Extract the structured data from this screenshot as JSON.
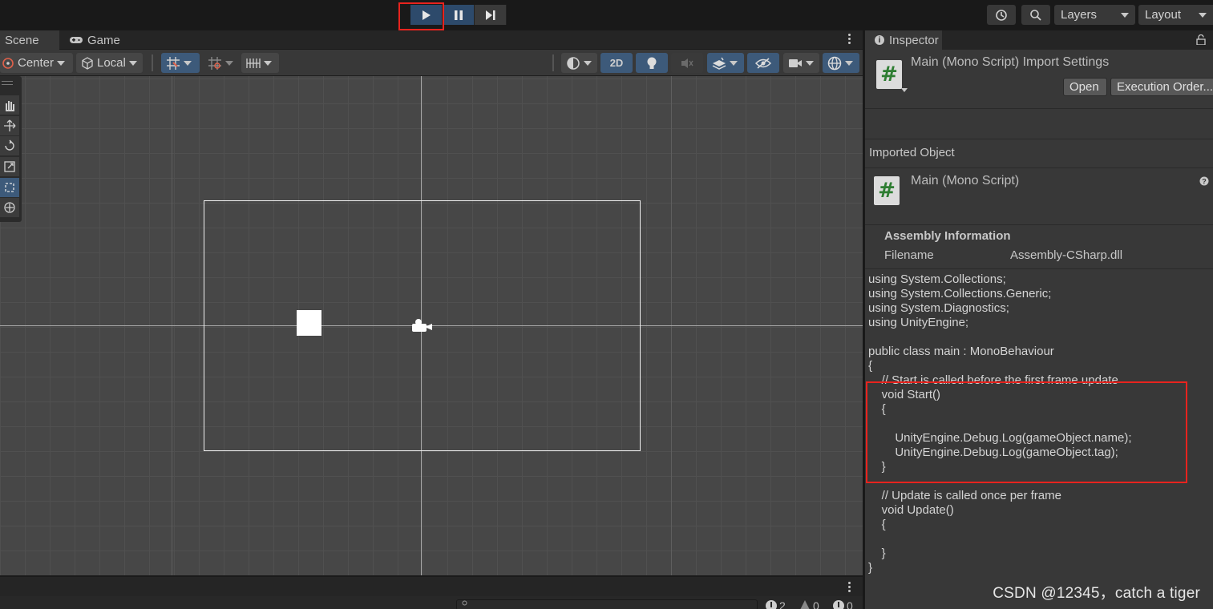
{
  "toolbar": {
    "play_icon": "play-icon",
    "pause_icon": "pause-icon",
    "step_icon": "step-icon",
    "history_icon": "history-icon",
    "search_icon": "search-icon",
    "layers_label": "Layers",
    "layout_label": "Layout",
    "highlight_color": "#e8231e"
  },
  "scene": {
    "tabs": [
      "Scene",
      "Game"
    ],
    "pivot_label": "Center",
    "space_label": "Local",
    "mode_2d_label": "2D"
  },
  "inspector": {
    "tab_label": "Inspector",
    "title": "Main (Mono Script) Import Settings",
    "open_label": "Open",
    "execution_order_label": "Execution Order...",
    "imported_object_label": "Imported Object",
    "object_name": "Main (Mono Script)",
    "assembly_heading": "Assembly Information",
    "filename_label": "Filename",
    "filename_value": "Assembly-CSharp.dll",
    "code": "using System.Collections;\nusing System.Collections.Generic;\nusing System.Diagnostics;\nusing UnityEngine;\n\npublic class main : MonoBehaviour\n{\n    // Start is called before the first frame update\n    void Start()\n    {\n\n        UnityEngine.Debug.Log(gameObject.name);\n        UnityEngine.Debug.Log(gameObject.tag);\n    }\n\n    // Update is called once per frame\n    void Update()\n    {\n\n    }\n}"
  },
  "console": {
    "error_count": "2",
    "warning_count": "0",
    "message_count": "0"
  },
  "watermark": "CSDN @12345，catch a tiger"
}
